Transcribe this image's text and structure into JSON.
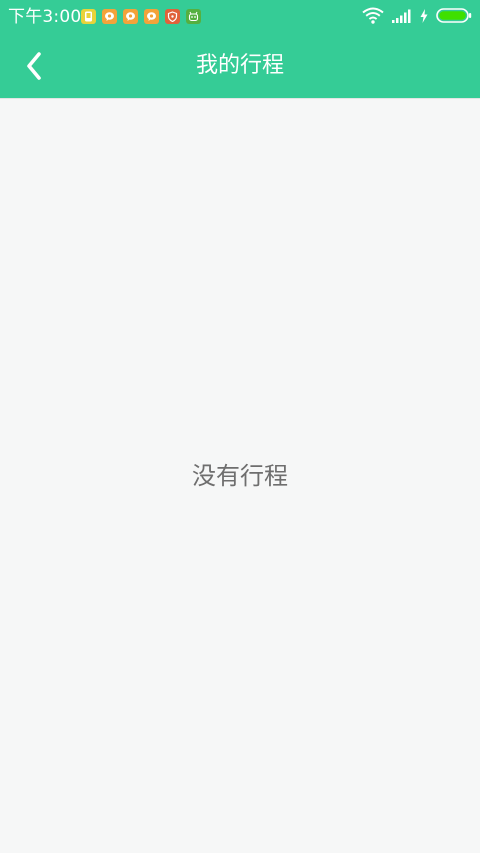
{
  "status_bar": {
    "time": "下午3:00",
    "notification_icons": [
      {
        "name": "phone-notif-icon",
        "color": "#e8d33a"
      },
      {
        "name": "chat-notif-icon",
        "color": "#f2a33a"
      },
      {
        "name": "chat-notif-icon",
        "color": "#f2a33a"
      },
      {
        "name": "chat-notif-icon",
        "color": "#f2a33a"
      },
      {
        "name": "shield-notif-icon",
        "color": "#e0623a"
      },
      {
        "name": "robot-notif-icon",
        "color": "#55b040"
      }
    ],
    "right_icons": [
      "wifi-icon",
      "signal-icon",
      "charging-icon",
      "battery-icon"
    ],
    "battery_level": 1.0
  },
  "app_bar": {
    "title": "我的行程",
    "back_icon": "chevron-left-icon",
    "background": "#35cc96"
  },
  "main": {
    "empty_message": "没有行程",
    "background": "#f6f7f7"
  }
}
